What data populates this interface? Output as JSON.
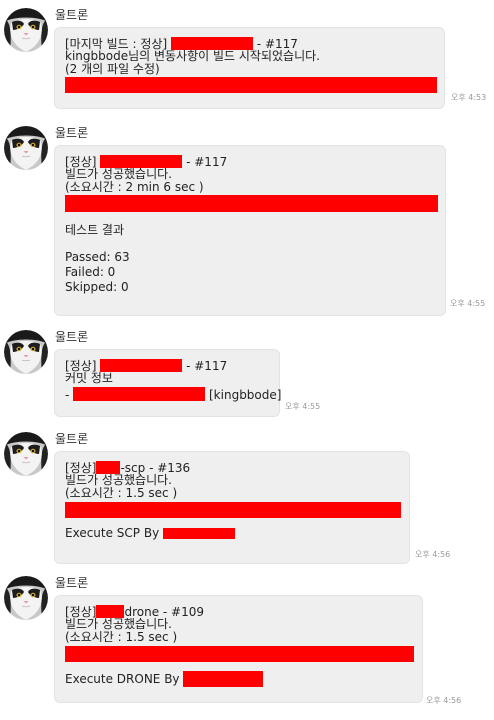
{
  "sender": "울트론",
  "redaction_color": "#ff0000",
  "messages": [
    {
      "lines": {
        "l1a": "[마지막 빌드 : 정상]",
        "l1b": "- #117",
        "l2": "kingbbode님의 변동사항이 빌드 시작되었습니다.",
        "l3": "(2 개의 파일 수정)"
      },
      "time": "오후 4:53"
    },
    {
      "lines": {
        "l1a": "[정상]",
        "l1b": "- #117",
        "l2": "빌드가 성공했습니다.",
        "l3": "(소요시간 : 2 min 6 sec )",
        "l4": "테스트 결과",
        "l5": "Passed: 63",
        "l6": "Failed: 0",
        "l7": "Skipped: 0"
      },
      "time": "오후 4:55"
    },
    {
      "lines": {
        "l1a": "[정상]",
        "l1b": "- #117",
        "l2": "커밋 정보",
        "l3a": "-",
        "l3b": "[kingbbode]"
      },
      "time": "오후 4:55"
    },
    {
      "lines": {
        "l1a": "[정상]",
        "l1b": "-scp - #136",
        "l2": "빌드가 성공했습니다.",
        "l3": "(소요시간 : 1.5 sec )",
        "l4": "Execute SCP By"
      },
      "time": "오후 4:56"
    },
    {
      "lines": {
        "l1a": "[정상]",
        "l1b": "drone - #109",
        "l2": "빌드가 성공했습니다.",
        "l3": "(소요시간 : 1.5 sec )",
        "l4": "Execute DRONE By"
      },
      "time": "오후 4:56"
    }
  ]
}
